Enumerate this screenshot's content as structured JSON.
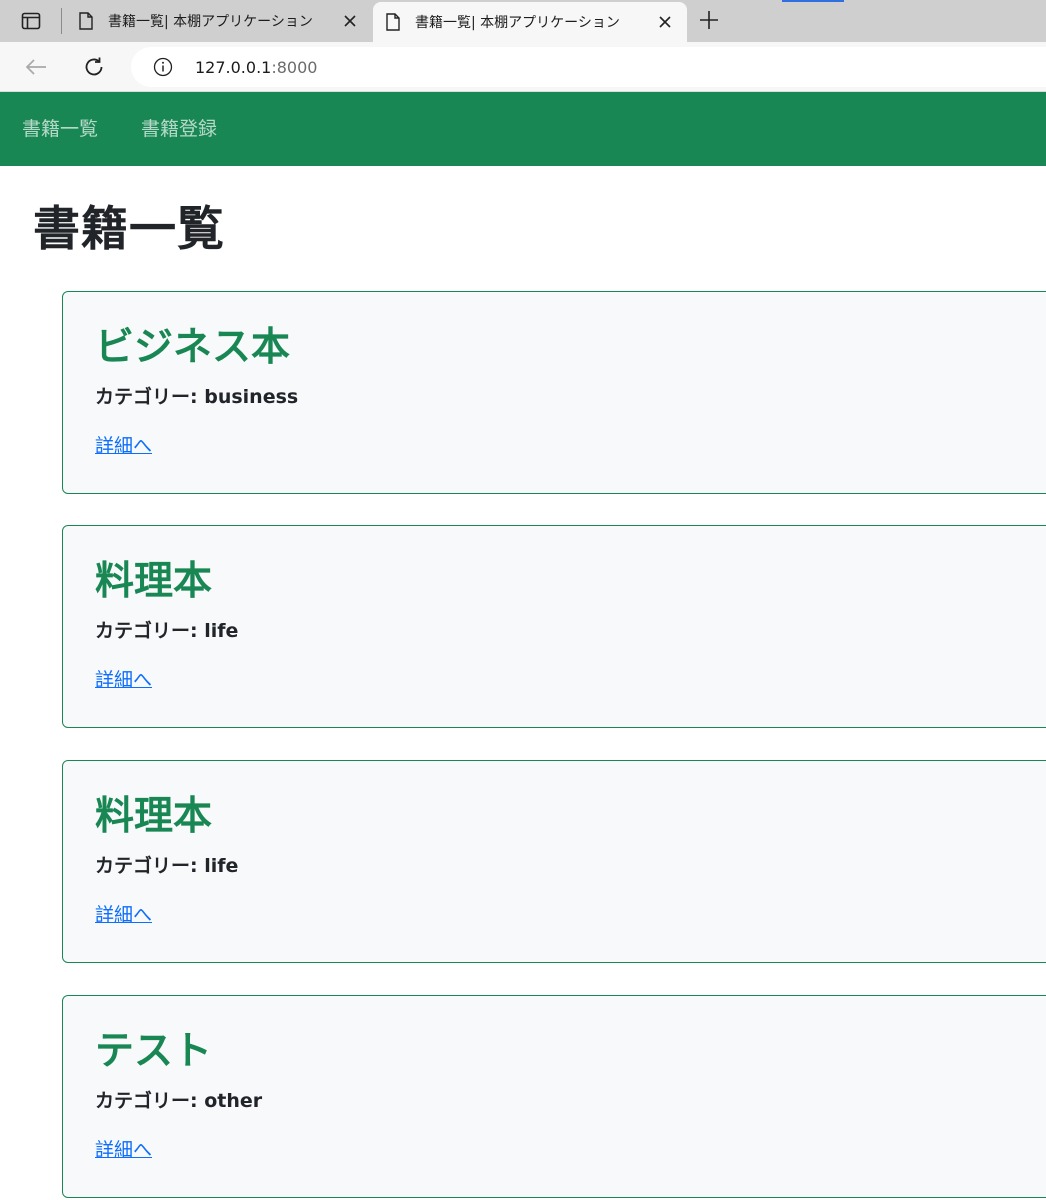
{
  "browser": {
    "tabs": [
      {
        "title": "書籍一覧| 本棚アプリケーション",
        "active": false
      },
      {
        "title": "書籍一覧| 本棚アプリケーション",
        "active": true
      }
    ],
    "address": {
      "host": "127.0.0.1",
      "port": ":8000"
    },
    "icons": {
      "tab_actions": "tab-actions-icon",
      "page": "page-icon",
      "close": "close-icon",
      "new_tab": "plus-icon",
      "back": "back-arrow-icon",
      "reload": "reload-icon",
      "site_info": "info-icon"
    }
  },
  "header": {
    "nav": [
      {
        "label": "書籍一覧"
      },
      {
        "label": "書籍登録"
      }
    ],
    "color": "#198754"
  },
  "main": {
    "title": "書籍一覧",
    "books": [
      {
        "title": "ビジネス本",
        "category": "カテゴリー: business",
        "link": "詳細へ"
      },
      {
        "title": "料理本",
        "category": "カテゴリー: life",
        "link": "詳細へ"
      },
      {
        "title": "料理本",
        "category": "カテゴリー: life",
        "link": "詳細へ"
      },
      {
        "title": "テスト",
        "category": "カテゴリー: other",
        "link": "詳細へ"
      }
    ]
  },
  "colors": {
    "accent": "#198754",
    "card_bg": "#f8f9fa",
    "link": "#0d6efd",
    "text": "#212529"
  }
}
